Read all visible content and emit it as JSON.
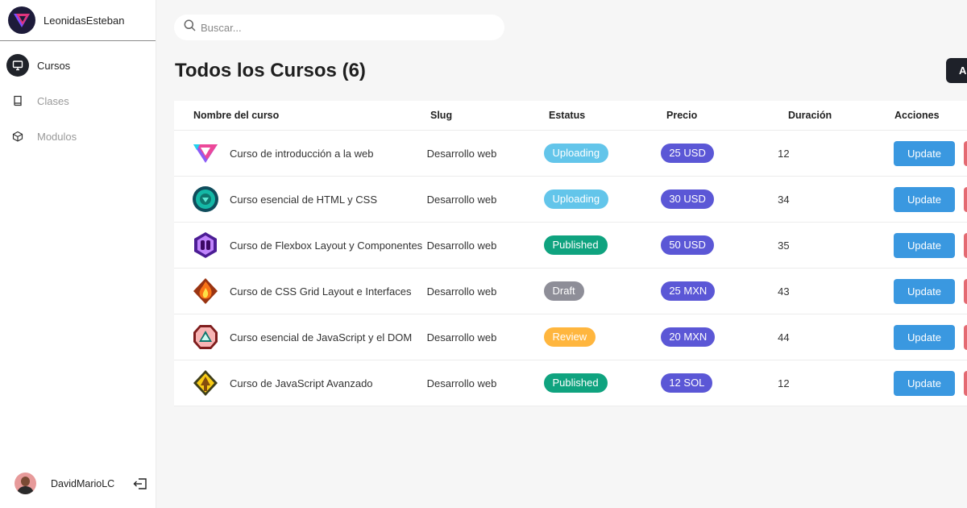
{
  "brand": {
    "name": "LeonidasEsteban"
  },
  "nav": [
    {
      "label": "Cursos",
      "icon": "monitor-icon",
      "active": true
    },
    {
      "label": "Clases",
      "icon": "book-icon",
      "active": false
    },
    {
      "label": "Modulos",
      "icon": "cube-icon",
      "active": false
    }
  ],
  "user": {
    "name": "DavidMarioLC"
  },
  "search": {
    "placeholder": "Buscar..."
  },
  "page": {
    "title": "Todos los Cursos (6)",
    "add_label": "A"
  },
  "table": {
    "headers": [
      "Nombre del curso",
      "Slug",
      "Estatus",
      "Precio",
      "Duración",
      "Acciones"
    ],
    "rows": [
      {
        "name": "Curso de introducción a la web",
        "slug": "Desarrollo web",
        "status": "Uploading",
        "price": "25 USD",
        "duration": "12",
        "action": "Update",
        "icon": "intro-web-icon"
      },
      {
        "name": "Curso esencial de HTML y CSS",
        "slug": "Desarrollo web",
        "status": "Uploading",
        "price": "30 USD",
        "duration": "34",
        "action": "Update",
        "icon": "html-css-icon"
      },
      {
        "name": "Curso de Flexbox Layout y Componentes",
        "slug": "Desarrollo web",
        "status": "Published",
        "price": "50 USD",
        "duration": "35",
        "action": "Update",
        "icon": "flexbox-icon"
      },
      {
        "name": "Curso de CSS Grid Layout e Interfaces",
        "slug": "Desarrollo web",
        "status": "Draft",
        "price": "25 MXN",
        "duration": "43",
        "action": "Update",
        "icon": "css-grid-flame-icon"
      },
      {
        "name": "Curso esencial de JavaScript y el DOM",
        "slug": "Desarrollo web",
        "status": "Review",
        "price": "20 MXN",
        "duration": "44",
        "action": "Update",
        "icon": "javascript-dom-icon"
      },
      {
        "name": "Curso de JavaScript Avanzado",
        "slug": "Desarrollo web",
        "status": "Published",
        "price": "12 SOL",
        "duration": "12",
        "action": "Update",
        "icon": "javascript-advanced-icon"
      }
    ]
  },
  "colors": {
    "status": {
      "Uploading": "#63c5ea",
      "Published": "#0fa37f",
      "Draft": "#8e8e98",
      "Review": "#ffb63e"
    },
    "price": "#5b57d6",
    "update": "#3a98e0",
    "delete": "#e46a72",
    "dark": "#1e2129"
  }
}
